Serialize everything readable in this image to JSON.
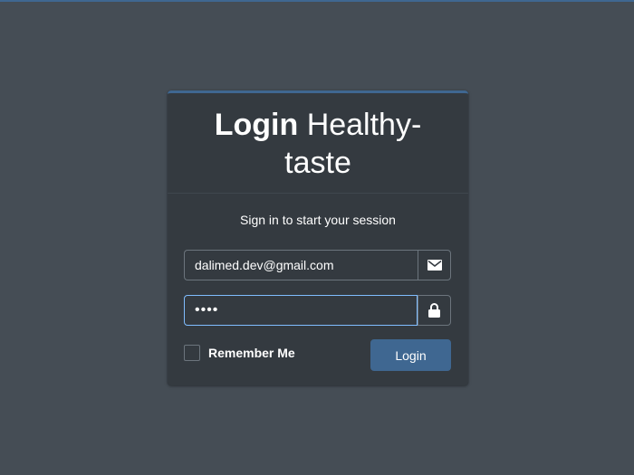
{
  "header": {
    "title_bold": "Login",
    "title_rest": "Healthy-taste"
  },
  "form": {
    "subtitle": "Sign in to start your session",
    "email": {
      "value": "dalimed.dev@gmail.com",
      "icon": "envelope-icon"
    },
    "password": {
      "value": "••••",
      "icon": "lock-icon"
    },
    "remember_me_label": "Remember Me",
    "remember_me_checked": false,
    "login_button_label": "Login"
  },
  "colors": {
    "background": "#454d55",
    "card": "#343a40",
    "accent": "#3f6791",
    "focus_border": "#80bdff"
  }
}
